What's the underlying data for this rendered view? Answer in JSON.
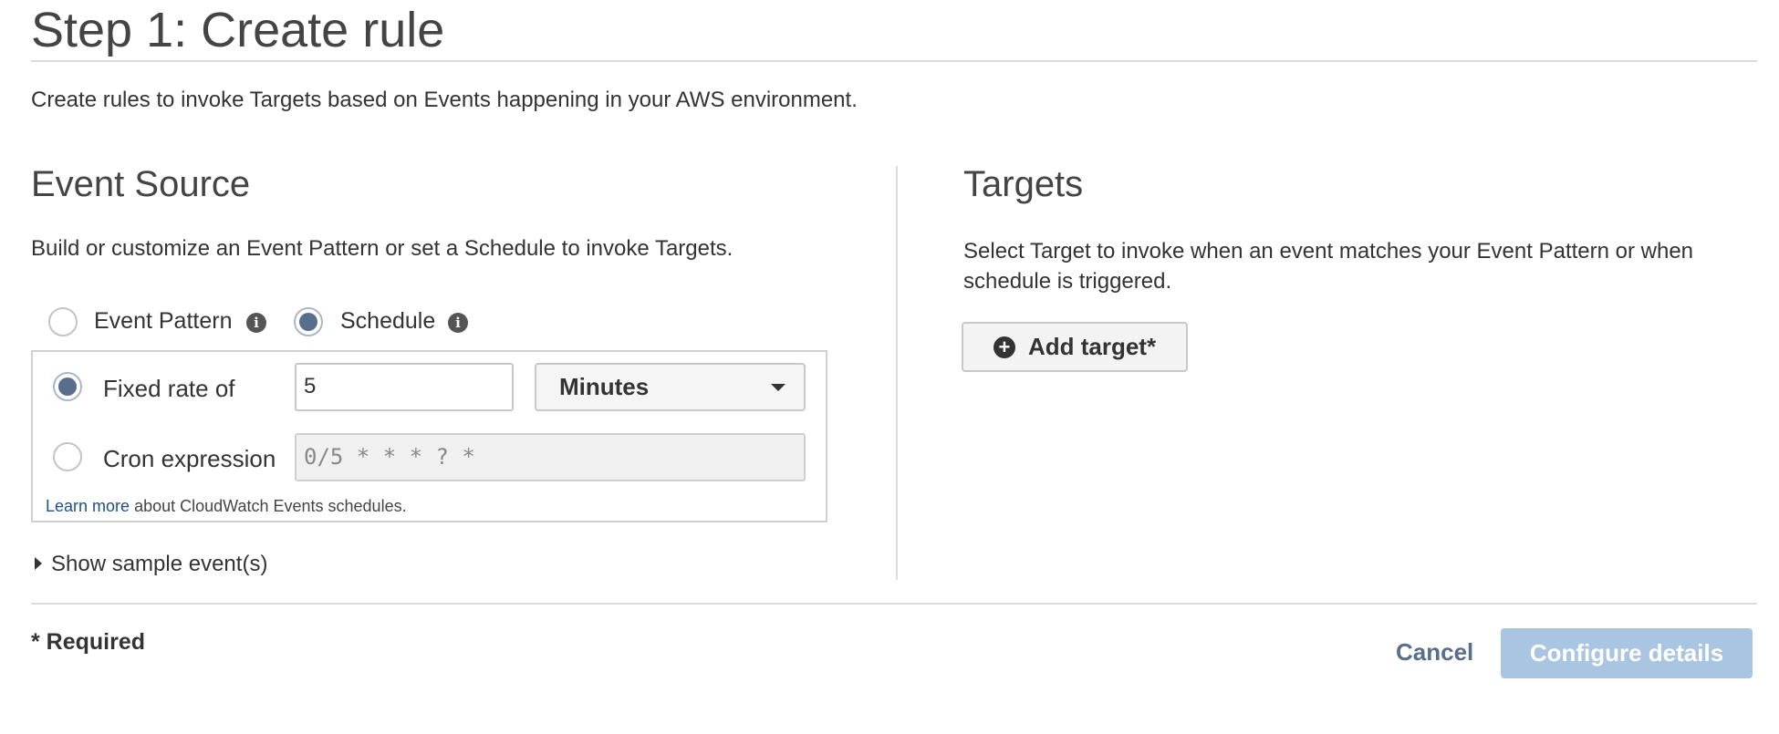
{
  "header": {
    "title": "Step 1: Create rule",
    "description": "Create rules to invoke Targets based on Events happening in your AWS environment."
  },
  "event_source": {
    "title": "Event Source",
    "description": "Build or customize an Event Pattern or set a Schedule to invoke Targets.",
    "options": [
      {
        "label": "Event Pattern",
        "selected": false
      },
      {
        "label": "Schedule",
        "selected": true
      }
    ],
    "schedule": {
      "fixed_rate_label": "Fixed rate of",
      "fixed_rate_selected": true,
      "rate_value": "5",
      "unit_selected": "Minutes",
      "cron_label": "Cron expression",
      "cron_selected": false,
      "cron_placeholder": "0/5 * * * ? *",
      "learn_more_link": "Learn more",
      "learn_more_text": "about CloudWatch Events schedules."
    },
    "show_sample_label": "Show sample event(s)"
  },
  "targets": {
    "title": "Targets",
    "description": "Select Target to invoke when an event matches your Event Pattern or when schedule is triggered.",
    "add_target_label": "Add target*"
  },
  "footer": {
    "required_label": "* Required",
    "cancel_label": "Cancel",
    "configure_label": "Configure details"
  },
  "icons": {
    "info": "info-icon",
    "add": "plus-circle-icon",
    "dropdown": "chevron-down-icon",
    "disclosure": "caret-right-icon"
  },
  "colors": {
    "radio_selected": "#586e8c",
    "link": "#1f4e8c",
    "primary_button_disabled": "#a9c5e1",
    "cancel_text": "#586e8c"
  }
}
